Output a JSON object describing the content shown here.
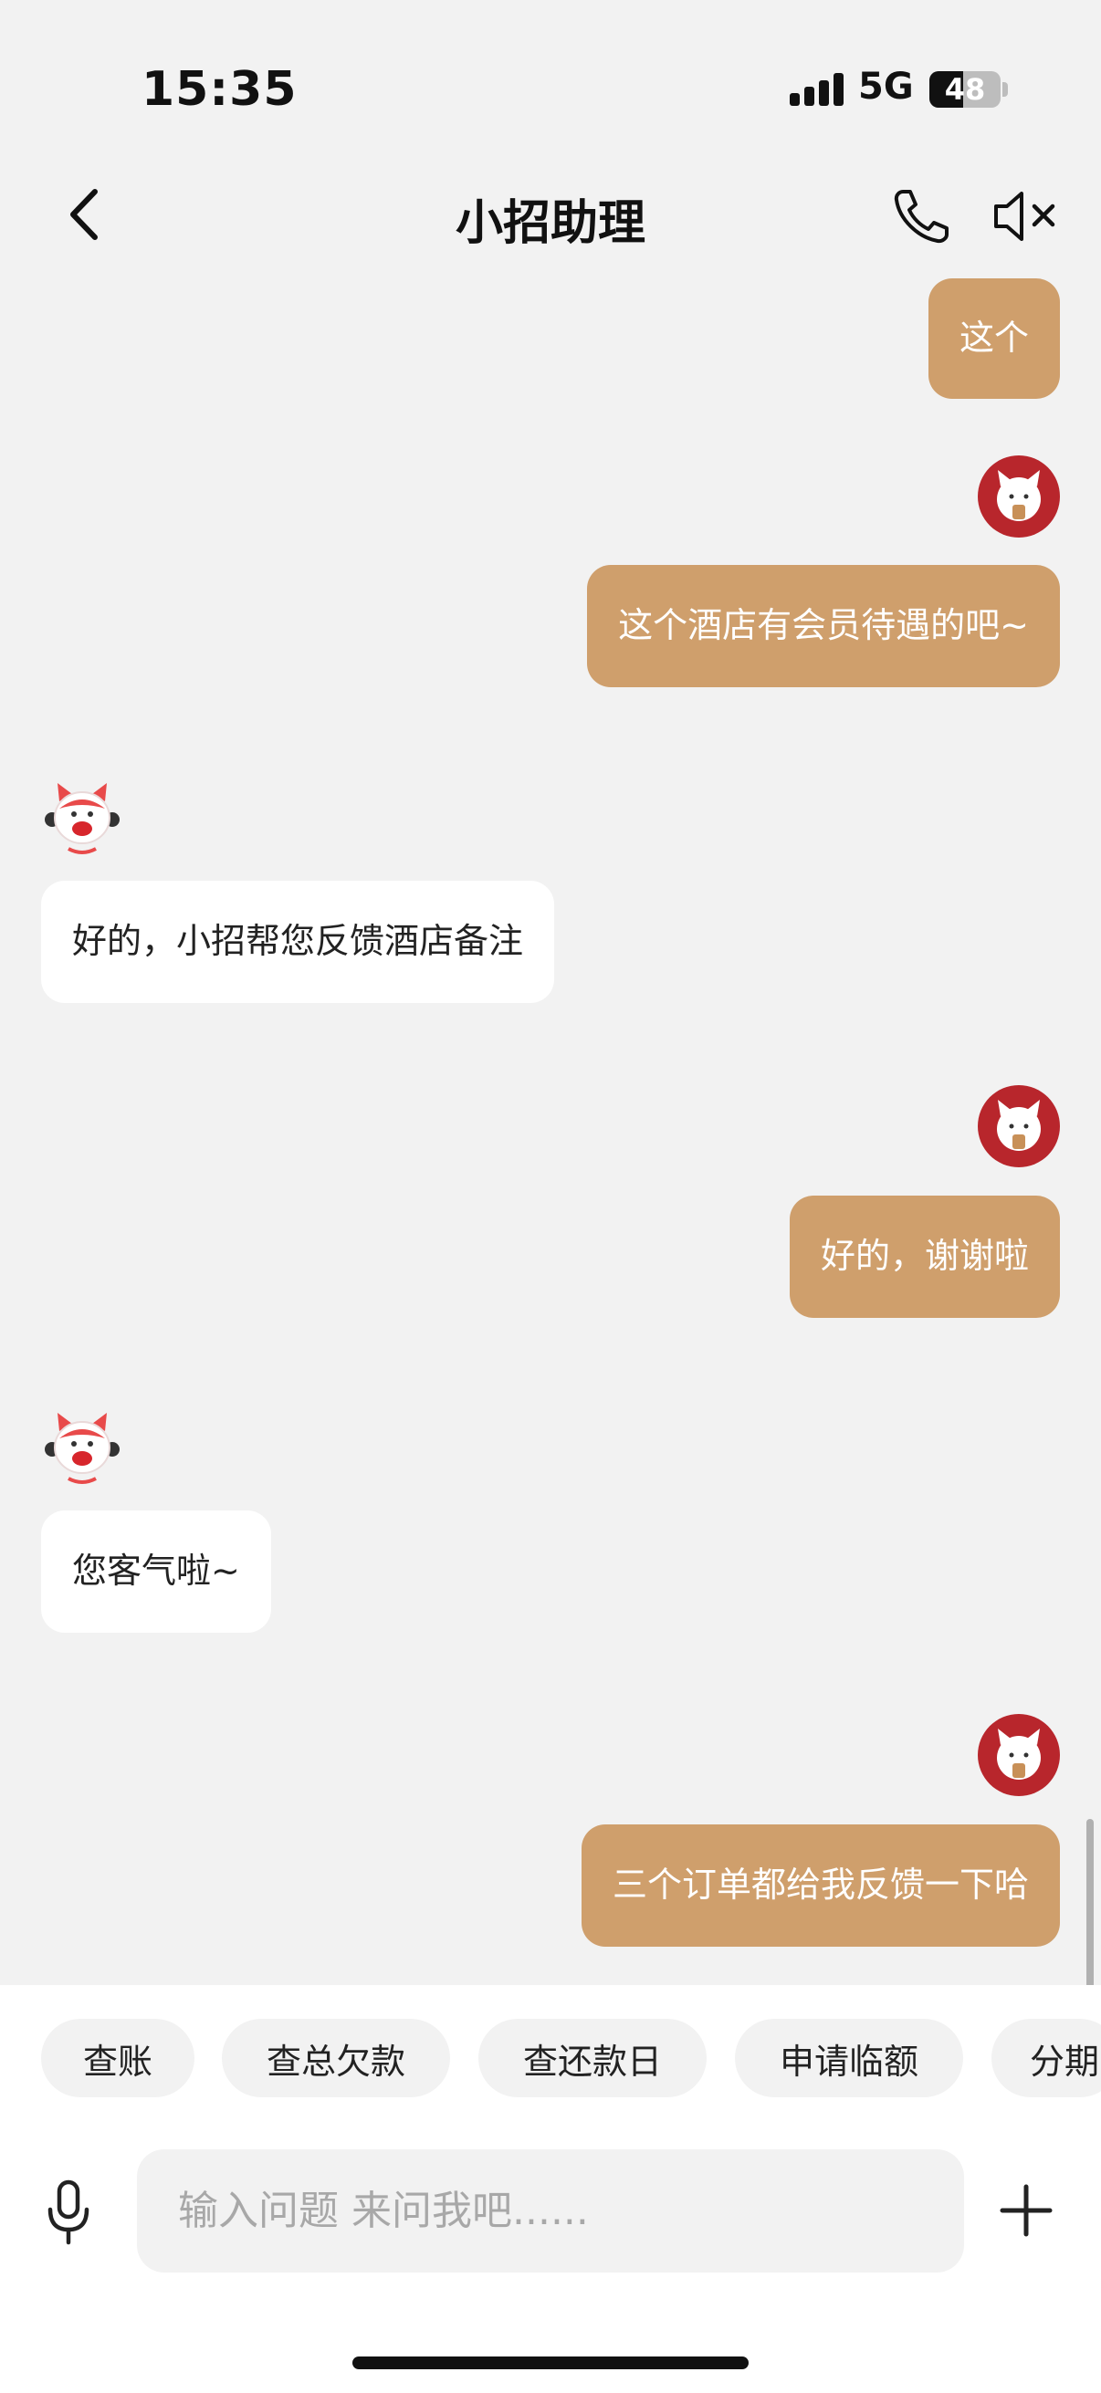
{
  "status_bar": {
    "time": "15:35",
    "network": "5G",
    "battery": "48",
    "battery_level": 0.48
  },
  "nav": {
    "title": "小招助理",
    "back_icon": "chevron-left-icon",
    "call_icon": "phone-icon",
    "mute_icon": "speaker-mute-icon"
  },
  "messages": [
    {
      "from": "me",
      "text": "这个"
    },
    {
      "from": "me",
      "text": "这个酒店有会员待遇的吧~"
    },
    {
      "from": "bot",
      "text": "好的，小招帮您反馈酒店备注"
    },
    {
      "from": "me",
      "text": "好的，谢谢啦"
    },
    {
      "from": "bot",
      "text": "您客气啦~"
    },
    {
      "from": "me",
      "text": "三个订单都给我反馈一下哈"
    }
  ],
  "quick_actions": [
    "查账",
    "查总欠款",
    "查还款日",
    "申请临额",
    "分期"
  ],
  "input": {
    "placeholder": "输入问题 来问我吧......",
    "value": ""
  },
  "colors": {
    "accent": "#cf9f6c",
    "background": "#f2f2f2",
    "user_avatar": "#b8262c"
  }
}
